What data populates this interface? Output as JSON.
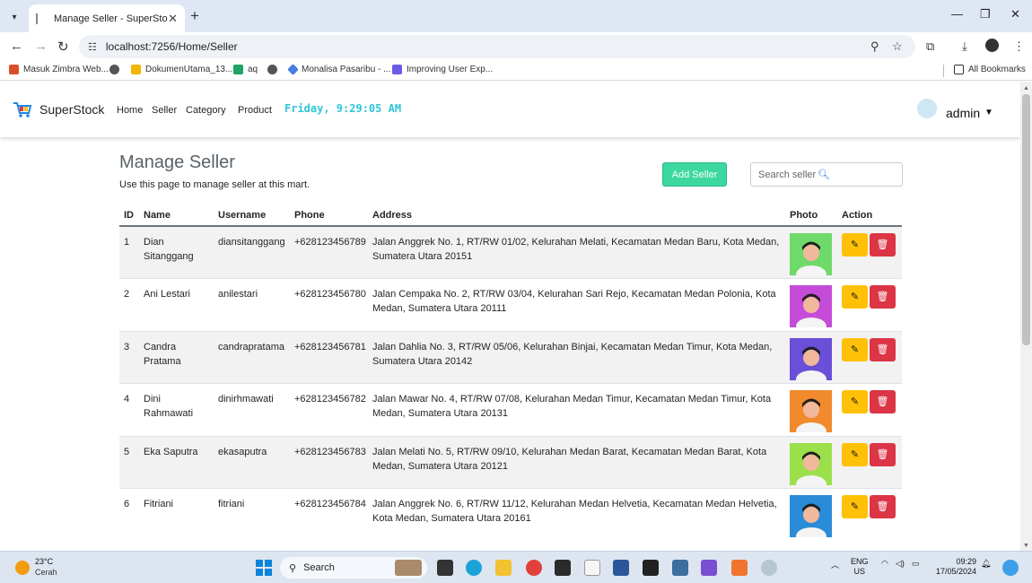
{
  "browser": {
    "tab_title": "Manage Seller - SuperStock",
    "url": "localhost:7256/Home/Seller",
    "bookmarks": [
      "Masuk Zimbra Web...",
      "DokumenUtama_13...",
      "aq",
      "Monalisa Pasaribu - ...",
      "Improving User Exp..."
    ],
    "all_bookmarks": "All Bookmarks"
  },
  "app": {
    "brand": "SuperStock",
    "nav": [
      "Home",
      "Seller",
      "Category",
      "Product"
    ],
    "clock": "Friday, 9:29:05 AM",
    "user": "admin"
  },
  "page": {
    "title": "Manage Seller",
    "subtitle": "Use this page to manage seller at this mart.",
    "add_button": "Add Seller",
    "search_placeholder": "Search seller"
  },
  "table": {
    "headers": [
      "ID",
      "Name",
      "Username",
      "Phone",
      "Address",
      "Photo",
      "Action"
    ],
    "rows": [
      {
        "id": "1",
        "name": "Dian Sitanggang",
        "username": "diansitanggang",
        "phone": "+628123456789",
        "address": "Jalan Anggrek No. 1, RT/RW 01/02, Kelurahan Melati, Kecamatan Medan Baru, Kota Medan, Sumatera Utara 20151",
        "photo_bg": "#6fd96a"
      },
      {
        "id": "2",
        "name": "Ani Lestari",
        "username": "anilestari",
        "phone": "+628123456780",
        "address": "Jalan Cempaka No. 2, RT/RW 03/04, Kelurahan Sari Rejo, Kecamatan Medan Polonia, Kota Medan, Sumatera Utara 20111",
        "photo_bg": "#c44cd9"
      },
      {
        "id": "3",
        "name": "Candra Pratama",
        "username": "candrapratama",
        "phone": "+628123456781",
        "address": "Jalan Dahlia No. 3, RT/RW 05/06, Kelurahan Binjai, Kecamatan Medan Timur, Kota Medan, Sumatera Utara 20142",
        "photo_bg": "#6a4fd8"
      },
      {
        "id": "4",
        "name": "Dini Rahmawati",
        "username": "dinirhmawati",
        "phone": "+628123456782",
        "address": "Jalan Mawar No. 4, RT/RW 07/08, Kelurahan Medan Timur, Kecamatan Medan Timur, Kota Medan, Sumatera Utara 20131",
        "photo_bg": "#f08a2c"
      },
      {
        "id": "5",
        "name": "Eka Saputra",
        "username": "ekasaputra",
        "phone": "+628123456783",
        "address": "Jalan Melati No. 5, RT/RW 09/10, Kelurahan Medan Barat, Kecamatan Medan Barat, Kota Medan, Sumatera Utara 20121",
        "photo_bg": "#9be04a"
      },
      {
        "id": "6",
        "name": "Fitriani",
        "username": "fitriani",
        "phone": "+628123456784",
        "address": "Jalan Anggrek No. 6, RT/RW 11/12, Kelurahan Medan Helvetia, Kecamatan Medan Helvetia, Kota Medan, Sumatera Utara 20161",
        "photo_bg": "#2a8bd8"
      }
    ]
  },
  "taskbar": {
    "weather_temp": "23°C",
    "weather_desc": "Cerah",
    "search_label": "Search",
    "lang_1": "ENG",
    "lang_2": "US",
    "time": "09:29",
    "date": "17/05/2024"
  },
  "colors": {
    "add_button": "#3cd8a0",
    "edit_button": "#ffc107",
    "delete_button": "#dc3545",
    "clock": "#2ec5d8"
  }
}
